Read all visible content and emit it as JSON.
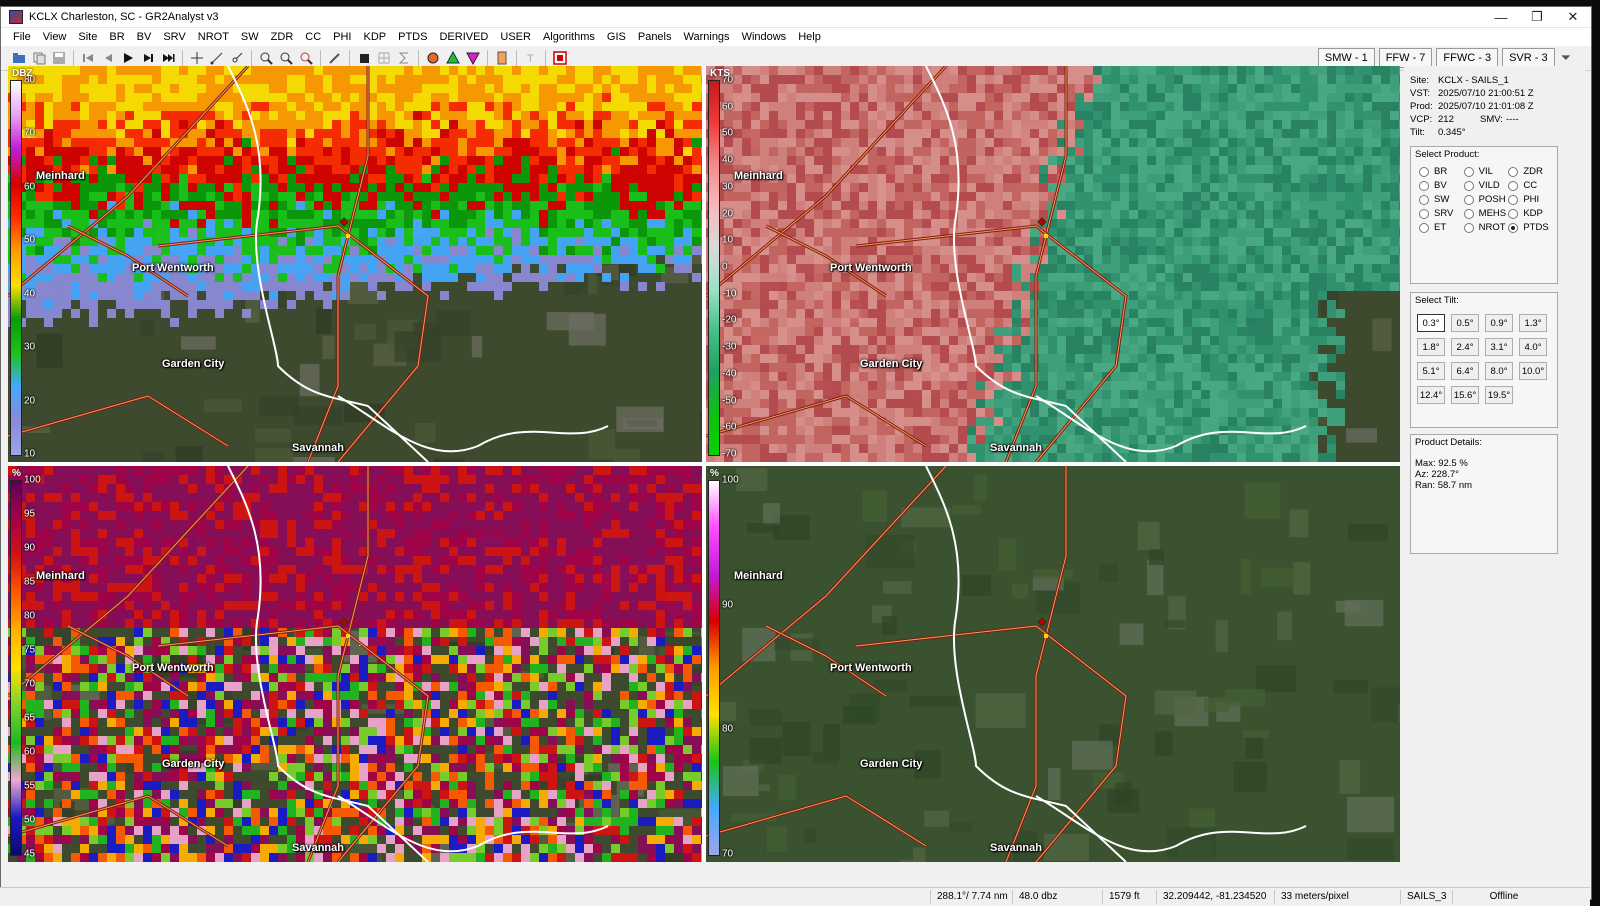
{
  "window": {
    "title": "KCLX Charleston, SC - GR2Analyst v3",
    "controls": [
      "—",
      "❐",
      "✕"
    ]
  },
  "menu": [
    "File",
    "View",
    "Site",
    "BR",
    "BV",
    "SRV",
    "NROT",
    "SW",
    "ZDR",
    "CC",
    "PHI",
    "KDP",
    "PTDS",
    "DERIVED",
    "USER",
    "Algorithms",
    "GIS",
    "Panels",
    "Warnings",
    "Windows",
    "Help"
  ],
  "toolbar": {
    "icons": [
      "open-icon",
      "copy-icon",
      "save-icon",
      "skip-start-icon",
      "step-back-icon",
      "play-icon",
      "step-forward-icon",
      "skip-end-icon",
      "crosshair-icon",
      "measure-icon",
      "link-icon",
      "zoom-in-icon",
      "zoom-out-icon",
      "zoom-reset-icon",
      "eyedropper-icon",
      "stop-icon",
      "grid-icon",
      "sigma-icon",
      "storm-icon",
      "triangle-green-icon",
      "triangle-magenta-icon",
      "marker-icon",
      "text-icon",
      "record-icon"
    ],
    "warnings": [
      "SMW - 1",
      "FFW - 7",
      "FFWC - 3",
      "SVR - 3"
    ]
  },
  "panes": [
    {
      "unit": "DBZ",
      "ticks": [
        "80",
        "70",
        "60",
        "50",
        "40",
        "30",
        "20",
        "10"
      ]
    },
    {
      "unit": "KTS",
      "ticks": [
        "70",
        "60",
        "50",
        "40",
        "30",
        "20",
        "10",
        "0",
        "-10",
        "-20",
        "-30",
        "-40",
        "-50",
        "-60",
        "-70"
      ]
    },
    {
      "unit": "%",
      "ticks": [
        "100",
        "95",
        "90",
        "85",
        "80",
        "75",
        "70",
        "65",
        "60",
        "55",
        "50",
        "45"
      ]
    },
    {
      "unit": "%",
      "ticks": [
        "100",
        "90",
        "80",
        "70"
      ]
    }
  ],
  "cities": [
    "Meinhard",
    "Port Wentworth",
    "Garden City",
    "Savannah"
  ],
  "site_info": {
    "site_label": "Site:",
    "site": "KCLX - SAILS_1",
    "vst_label": "VST:",
    "vst": "2025/07/10  21:00:51 Z",
    "prod_label": "Prod:",
    "prod": "2025/07/10  21:01:08 Z",
    "vcp_label": "VCP:",
    "vcp": "212",
    "smv_label": "SMV:",
    "smv": "----",
    "tilt_label": "Tilt:",
    "tilt": "0.345°"
  },
  "select_product": {
    "title": "Select Product:",
    "options": [
      "BR",
      "VIL",
      "ZDR",
      "BV",
      "VILD",
      "CC",
      "SW",
      "POSH",
      "PHI",
      "SRV",
      "MEHS",
      "KDP",
      "ET",
      "NROT",
      "PTDS"
    ],
    "selected": "PTDS"
  },
  "select_tilt": {
    "title": "Select Tilt:",
    "options": [
      "0.3°",
      "0.5°",
      "0.9°",
      "1.3°",
      "1.8°",
      "2.4°",
      "3.1°",
      "4.0°",
      "5.1°",
      "6.4°",
      "8.0°",
      "10.0°",
      "12.4°",
      "15.6°",
      "19.5°"
    ],
    "selected": "0.3°"
  },
  "product_details": {
    "title": "Product Details:",
    "max": "Max:  92.5 %",
    "az": "Az:   228.7°",
    "ran": "Ran:  58.7 nm"
  },
  "status": {
    "azran": "288.1°/ 7.74 nm",
    "value": "48.0 dbz",
    "height": "1579 ft",
    "latlon": "32.209442, -81.234520",
    "scale": "33 meters/pixel",
    "mode": "SAILS_3",
    "conn": "Offline"
  }
}
